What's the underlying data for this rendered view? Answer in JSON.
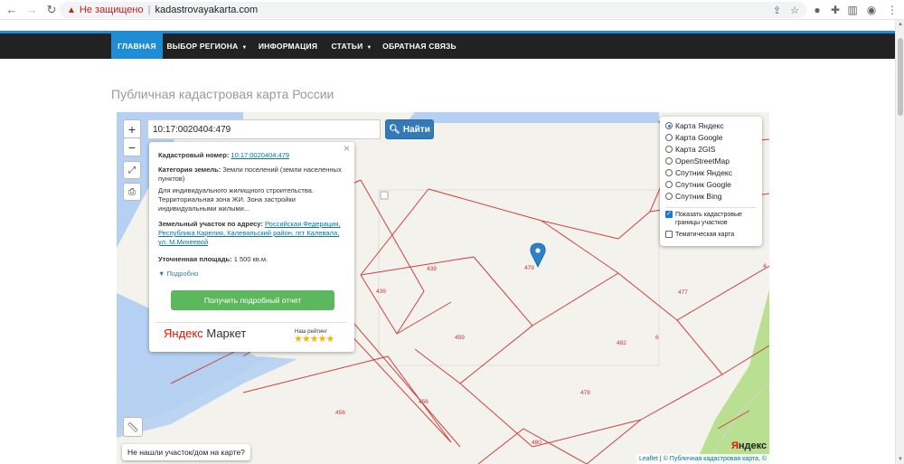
{
  "browser": {
    "security_label": "Не защищено",
    "url": "kadastrovayakarta.com"
  },
  "nav": {
    "items": [
      "ГЛАВНАЯ",
      "ВЫБОР РЕГИОНА",
      "ИНФОРМАЦИЯ",
      "СТАТЬИ",
      "ОБРАТНАЯ СВЯЗЬ"
    ]
  },
  "page": {
    "title": "Публичная кадастровая карта России"
  },
  "map": {
    "search_value": "10:17:0020404:479",
    "search_button": "Найти",
    "zoom_in": "+",
    "zoom_out": "−",
    "popup": {
      "cadastral_label": "Кадастровый номер:",
      "cadastral_value": "10:17:0020404:479",
      "category_label": "Категория земель:",
      "category_value_1": "Земли поселений (земли населенных пунктов)",
      "category_value_2": "Для индивидуального жилищного строительства. Территориальная зона ЖИ. Зона застройки индивидуальными жилыми...",
      "address_label": "Земельный участок по адресу:",
      "address_value": "Российская Федерация, Республика Карелия, Калевальский район, пгт Калевала, ул. М.Михеевой",
      "area_label": "Уточненная площадь:",
      "area_value": "1 500 кв.м.",
      "more_label": "Подробно",
      "report_button": "Получить подробный отчет",
      "market_logo_1": "Яндекс",
      "market_logo_2": "Маркет",
      "rating_label": "Наш рейтинг",
      "rating_stars": "★★★★★"
    },
    "layers": {
      "options": [
        "Карта Яндекс",
        "Карта Google",
        "Карта 2GIS",
        "OpenStreetMap",
        "Спутник Яндекс",
        "Спутник Google",
        "Спутник Bing"
      ],
      "selected_index": 0,
      "checkbox_cadastral": "Показать кадастровые границы участков",
      "checkbox_thematic": "Тематическая карта"
    },
    "parcel_labels": [
      "439",
      "479",
      "439",
      "477",
      "459",
      "482",
      "6",
      "478",
      "456",
      "456",
      "480",
      "4"
    ],
    "not_found_button": "Не нашли участок/дом на карте?",
    "attribution_leaflet": "Leaflet",
    "attribution_text": "© Публичная кадастровая карта, ©",
    "yandex_logo_y": "Я",
    "yandex_logo_rest": "ндекс",
    "colors": {
      "nav_bg": "#222222",
      "nav_active": "#1f8dd6",
      "parcel_line": "#d04040",
      "water": "#b5d0f2",
      "green": "#b8e090",
      "report_button": "#5cb85c",
      "search_button": "#337ab7"
    }
  }
}
